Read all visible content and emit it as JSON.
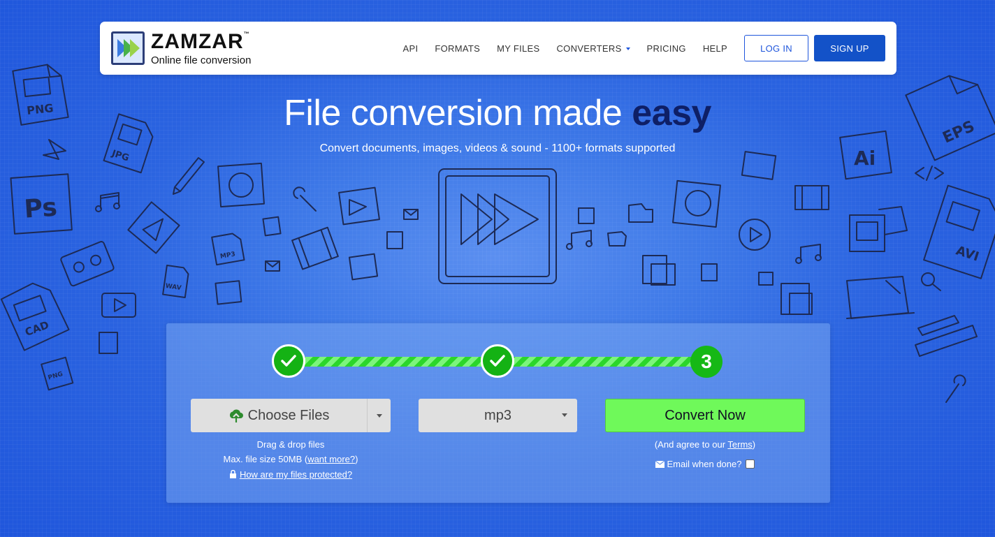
{
  "header": {
    "logo_name": "ZAMZAR",
    "logo_tm": "™",
    "logo_tagline": "Online file conversion",
    "nav": [
      {
        "label": "API"
      },
      {
        "label": "FORMATS"
      },
      {
        "label": "MY FILES"
      },
      {
        "label": "CONVERTERS"
      },
      {
        "label": "PRICING"
      },
      {
        "label": "HELP"
      }
    ],
    "login_label": "LOG IN",
    "signup_label": "SIGN UP"
  },
  "hero": {
    "title_main": "File conversion made ",
    "title_emphasis": "easy",
    "subtitle": "Convert documents, images, videos & sound - 1100+ formats supported"
  },
  "decor_labels": [
    "PNG",
    "JPG",
    "Ps",
    "EPS",
    "Ai",
    "CAD",
    "AVI",
    "MP3",
    "WAV",
    "PNG"
  ],
  "converter": {
    "steps": [
      {
        "state": "done",
        "icon": "check-icon"
      },
      {
        "state": "done",
        "icon": "check-icon"
      },
      {
        "state": "current",
        "number": "3"
      }
    ],
    "choose_files_label": "Choose Files",
    "format_value": "mp3",
    "convert_label": "Convert Now",
    "drag_drop_text": "Drag & drop files",
    "max_size_text": "Max. file size 50MB (",
    "want_more_link": "want more?",
    "max_size_close": ")",
    "protected_link": "How are my files protected?",
    "agree_text": "(And agree to our ",
    "terms_link": "Terms",
    "agree_close": ")",
    "email_label": "Email when done?",
    "email_checked": false
  },
  "colors": {
    "background": "#2a63e0",
    "signup_button": "#1352c8",
    "convert_button": "#6ff95a",
    "step_green": "#14b214",
    "title_emphasis": "#0e1f66"
  }
}
